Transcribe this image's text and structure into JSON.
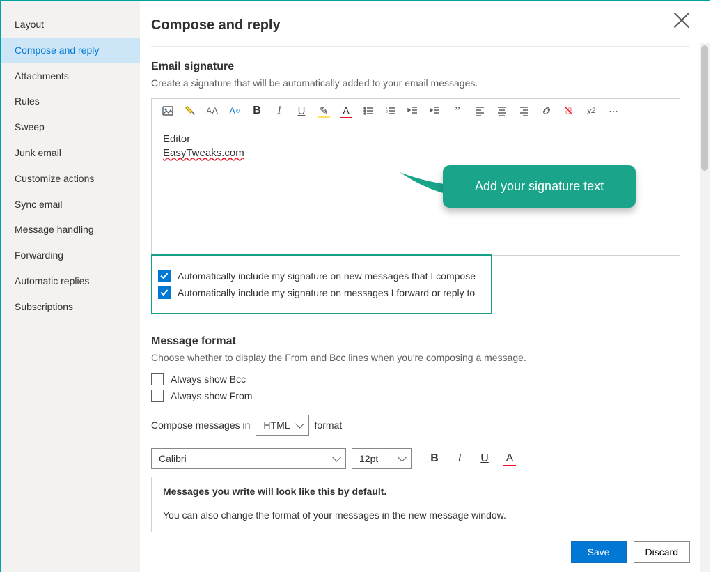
{
  "sidebar": {
    "items": [
      {
        "label": "Layout"
      },
      {
        "label": "Compose and reply"
      },
      {
        "label": "Attachments"
      },
      {
        "label": "Rules"
      },
      {
        "label": "Sweep"
      },
      {
        "label": "Junk email"
      },
      {
        "label": "Customize actions"
      },
      {
        "label": "Sync email"
      },
      {
        "label": "Message handling"
      },
      {
        "label": "Forwarding"
      },
      {
        "label": "Automatic replies"
      },
      {
        "label": "Subscriptions"
      }
    ],
    "activeIndex": 1
  },
  "page": {
    "title": "Compose and reply"
  },
  "signature": {
    "heading": "Email signature",
    "description": "Create a signature that will be automatically added to your email messages.",
    "body_line1": "Editor",
    "body_line2": "EasyTweaks.com",
    "callout": "Add your signature text",
    "checkbox_new": "Automatically include my signature on new messages that I compose",
    "checkbox_reply": "Automatically include my signature on messages I forward or reply to"
  },
  "toolbar_icons": [
    "insert-image-icon",
    "format-painter-icon",
    "font-size-icon",
    "font-size-down-icon",
    "bold-icon",
    "italic-icon",
    "underline-icon",
    "highlight-icon",
    "font-color-icon",
    "bulleted-list-icon",
    "numbered-list-icon",
    "decrease-indent-icon",
    "increase-indent-icon",
    "quote-icon",
    "align-left-icon",
    "align-center-icon",
    "align-right-icon",
    "insert-link-icon",
    "remove-link-icon",
    "superscript-icon",
    "more-icon"
  ],
  "format": {
    "heading": "Message format",
    "description": "Choose whether to display the From and Bcc lines when you're composing a message.",
    "checkbox_bcc": "Always show Bcc",
    "checkbox_from": "Always show From",
    "compose_prefix": "Compose messages in",
    "compose_value": "HTML",
    "compose_suffix": "format",
    "font_value": "Calibri",
    "size_value": "12pt",
    "preview_line1": "Messages you write will look like this by default.",
    "preview_line2": "You can also change the format of your messages in the new message window."
  },
  "footer": {
    "save": "Save",
    "discard": "Discard"
  }
}
